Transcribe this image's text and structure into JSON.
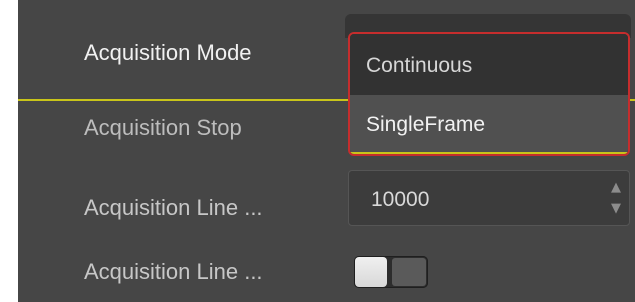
{
  "properties": [
    {
      "label": "Acquisition Mode"
    },
    {
      "label": "Acquisition Stop"
    },
    {
      "label": "Acquisition Line ..."
    },
    {
      "label": "Acquisition Line ..."
    }
  ],
  "acquisition_mode": {
    "options": [
      "Continuous",
      "SingleFrame"
    ],
    "highlighted_option": "SingleFrame"
  },
  "acquisition_line_spinner": {
    "value": "10000",
    "up_symbol": "▲",
    "down_symbol": "▼"
  },
  "toggle": {
    "state": "off"
  },
  "colors": {
    "panel_bg": "#464646",
    "selected_row_underline": "#c9c51a",
    "dropdown_highlight_border": "#c62d2d",
    "dropdown_bg": "#2f2f2f",
    "dropdown_option_hover": "#505050"
  },
  "icons": {
    "spinner_up": "arrow-up-icon",
    "spinner_down": "arrow-down-icon"
  }
}
